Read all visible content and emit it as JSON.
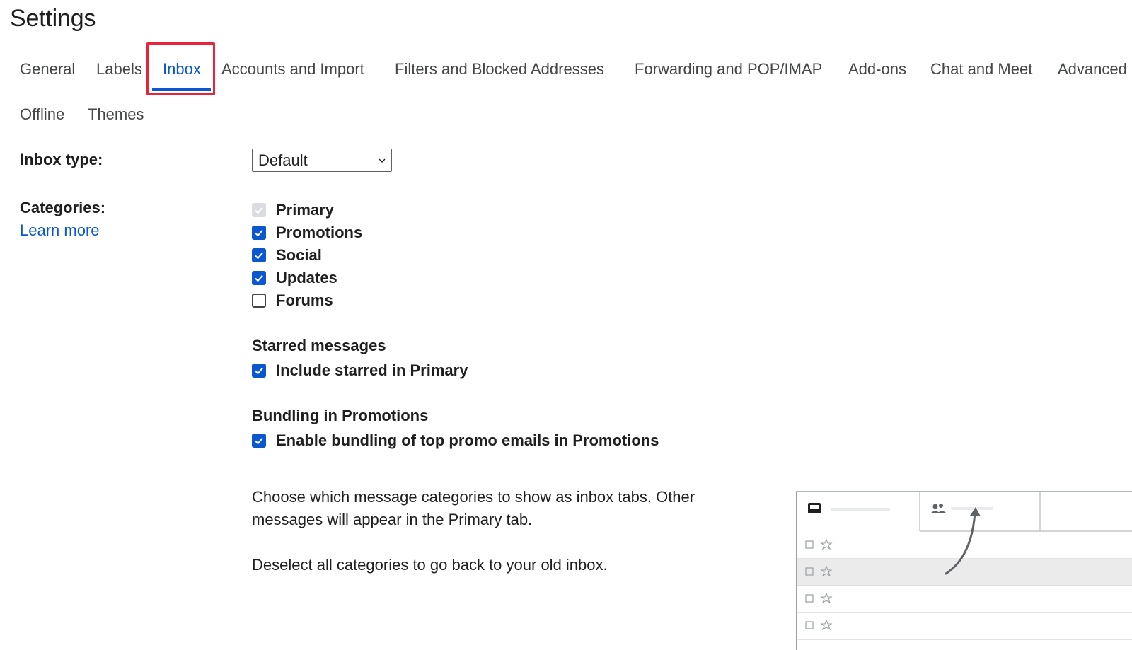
{
  "page": {
    "title": "Settings"
  },
  "tabs": [
    {
      "label": "General",
      "active": false
    },
    {
      "label": "Labels",
      "active": false
    },
    {
      "label": "Inbox",
      "active": true
    },
    {
      "label": "Accounts and Import",
      "active": false
    },
    {
      "label": "Filters and Blocked Addresses",
      "active": false
    },
    {
      "label": "Forwarding and POP/IMAP",
      "active": false
    },
    {
      "label": "Add-ons",
      "active": false
    },
    {
      "label": "Chat and Meet",
      "active": false
    },
    {
      "label": "Advanced",
      "active": false
    },
    {
      "label": "Offline",
      "active": false
    },
    {
      "label": "Themes",
      "active": false
    }
  ],
  "inbox_type": {
    "label": "Inbox type:",
    "selected": "Default"
  },
  "categories": {
    "label": "Categories:",
    "learn_more": "Learn more",
    "items": [
      {
        "label": "Primary",
        "checked": true,
        "disabled": true
      },
      {
        "label": "Promotions",
        "checked": true
      },
      {
        "label": "Social",
        "checked": true
      },
      {
        "label": "Updates",
        "checked": true
      },
      {
        "label": "Forums",
        "checked": false
      }
    ]
  },
  "starred": {
    "heading": "Starred messages",
    "option": {
      "label": "Include starred in Primary",
      "checked": true
    }
  },
  "bundling": {
    "heading": "Bundling in Promotions",
    "option": {
      "label": "Enable bundling of top promo emails in Promotions",
      "checked": true
    }
  },
  "descriptions": {
    "line1": "Choose which message categories to show as inbox tabs. Other messages will appear in the Primary tab.",
    "line2": "Deselect all categories to go back to your old inbox."
  },
  "colors": {
    "accent": "#0b57d0",
    "highlight": "#e8233a",
    "text": "#1f1f1f",
    "muted_text": "#444746"
  },
  "icons": {
    "checkbox_checked": "check-icon",
    "dropdown": "chevron-down-icon",
    "illustration_tab1": "inbox-icon",
    "illustration_tab2": "people-icon"
  }
}
